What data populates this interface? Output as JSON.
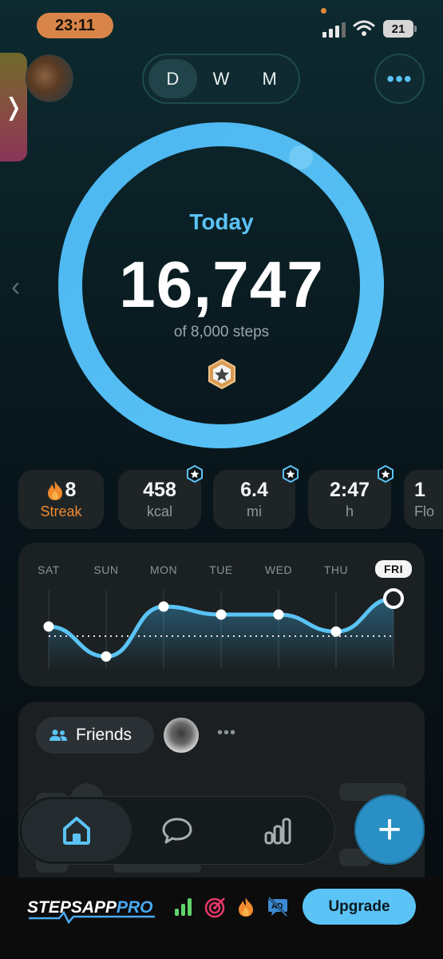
{
  "status_bar": {
    "time": "23:11",
    "battery": "21"
  },
  "period_tabs": [
    {
      "label": "D",
      "active": true
    },
    {
      "label": "W",
      "active": false
    },
    {
      "label": "M",
      "active": false
    }
  ],
  "more_button": "•••",
  "ring": {
    "title": "Today",
    "steps": "16,747",
    "goal_text": "of 8,000 steps",
    "progress": 1.0
  },
  "stats": [
    {
      "value": "8",
      "label": "Streak",
      "icon": "flame-icon"
    },
    {
      "value": "458",
      "label": "kcal"
    },
    {
      "value": "6.4",
      "label": "mi"
    },
    {
      "value": "2:47",
      "label": "h"
    },
    {
      "value": "1",
      "label": "Flo"
    }
  ],
  "week_chart": {
    "days": [
      "SAT",
      "SUN",
      "MON",
      "TUE",
      "WED",
      "THU",
      "FRI"
    ],
    "active_day": "FRI",
    "relative_levels": [
      0.72,
      0.42,
      0.92,
      0.84,
      0.84,
      0.67,
      1.0
    ],
    "goal_level": 0.72
  },
  "friends": {
    "label": "Friends",
    "more": "•••"
  },
  "promo": {
    "brand_left": "STEPSAPP",
    "brand_right": "PRO",
    "upgrade_label": "Upgrade"
  },
  "colors": {
    "accent": "#5bc3f5",
    "streak": "#f08a2c",
    "fab": "#2a8fc4"
  }
}
